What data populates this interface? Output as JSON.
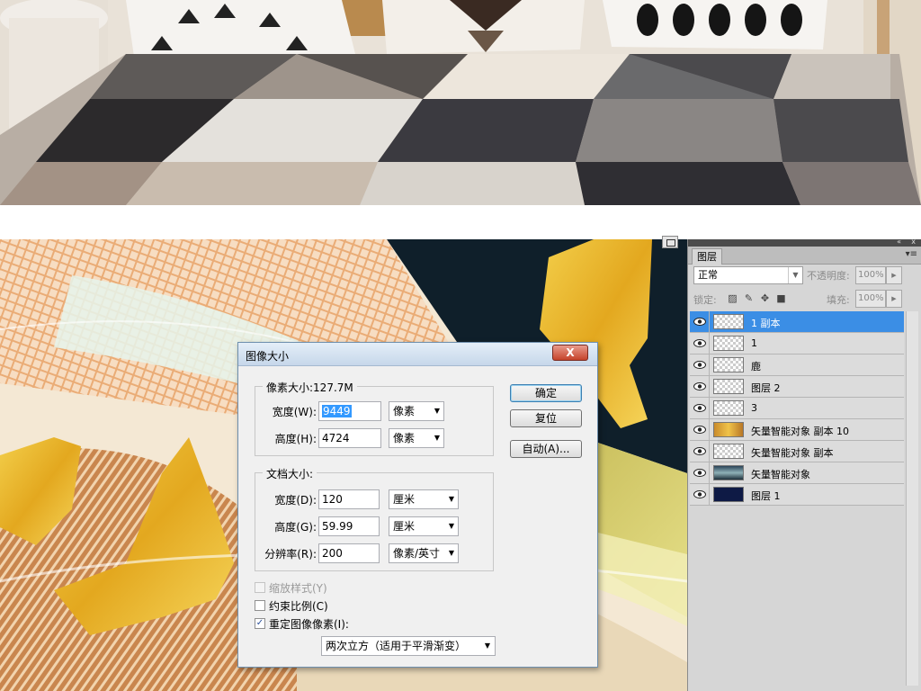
{
  "dialog": {
    "title": "图像大小",
    "close_label": "X",
    "pixel_dimensions": {
      "title": "像素大小:127.7M",
      "width_label": "宽度(W):",
      "width_value": "9449",
      "width_unit": "像素",
      "height_label": "高度(H):",
      "height_value": "4724",
      "height_unit": "像素"
    },
    "document_size": {
      "title": "文档大小:",
      "width_label": "宽度(D):",
      "width_value": "120",
      "width_unit": "厘米",
      "height_label": "高度(G):",
      "height_value": "59.99",
      "height_unit": "厘米",
      "resolution_label": "分辨率(R):",
      "resolution_value": "200",
      "resolution_unit": "像素/英寸"
    },
    "options": {
      "scale_styles": {
        "label": "缩放样式(Y)",
        "checked": false,
        "enabled": false
      },
      "constrain_proportions": {
        "label": "约束比例(C)",
        "checked": false,
        "enabled": true
      },
      "resample": {
        "label": "重定图像像素(I):",
        "checked": true,
        "enabled": true
      },
      "resample_method": "两次立方（适用于平滑渐变）"
    },
    "buttons": {
      "ok": "确定",
      "reset": "复位",
      "auto": "自动(A)..."
    }
  },
  "layers_panel": {
    "tab": "图层",
    "collapse_icon": "«",
    "close_icon": "x",
    "menu_icon": "▾≡",
    "blend_mode": "正常",
    "opacity_label": "不透明度:",
    "opacity_value": "100%",
    "lock_label": "锁定:",
    "fill_label": "填充:",
    "fill_value": "100%",
    "layers": [
      {
        "name": "1 副本",
        "thumb": "transparent",
        "selected": true
      },
      {
        "name": "1",
        "thumb": "transparent",
        "selected": false
      },
      {
        "name": "鹿",
        "thumb": "deer",
        "selected": false
      },
      {
        "name": "图层 2",
        "thumb": "transparent",
        "selected": false
      },
      {
        "name": "3",
        "thumb": "transparent",
        "selected": false
      },
      {
        "name": "矢量智能对象 副本 10",
        "thumb": "gold",
        "selected": false
      },
      {
        "name": "矢量智能对象 副本",
        "thumb": "transparent",
        "selected": false
      },
      {
        "name": "矢量智能对象",
        "thumb": "wave",
        "selected": false
      },
      {
        "name": "图层 1",
        "thumb": "navy",
        "selected": false
      }
    ]
  },
  "colors": {
    "selection_blue": "#3b8ee5",
    "gold": "#e6b12a",
    "navy_bg": "#0f1f2a",
    "dialog_bg": "#f0f0f0"
  }
}
